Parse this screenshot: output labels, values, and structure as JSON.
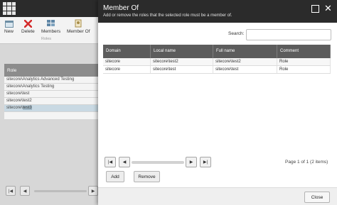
{
  "app": {
    "ribbon": {
      "new_label": "New",
      "delete_label": "Delete",
      "members_label": "Members",
      "member_of_label": "Member Of",
      "group_label": "Roles"
    },
    "role_list": {
      "header": "Role",
      "rows": [
        "sitecore\\Analytics Advanced Testing",
        "sitecore\\Analytics Testing",
        "sitecore\\test",
        "sitecore\\test2"
      ],
      "selected_prefix": "sitecore\\",
      "selected_highlight": "test3"
    },
    "pager": {
      "first": "|◀",
      "prev": "◀",
      "next": "▶"
    }
  },
  "dialog": {
    "title": "Member Of",
    "subtitle": "Add or remove the roles that the selected role must be a member of.",
    "search_label": "Search:",
    "search_value": "",
    "columns": [
      "Domain",
      "Local name",
      "Full name",
      "Comment"
    ],
    "rows": [
      [
        "sitecore",
        "sitecore\\test2",
        "sitecore\\test2",
        "Role"
      ],
      [
        "sitecore",
        "sitecore\\test",
        "sitecore\\test",
        "Role"
      ]
    ],
    "pager": {
      "first": "|◀",
      "prev": "◀",
      "next": "▶",
      "last": "▶|",
      "info": "Page 1 of 1 (2 items)"
    },
    "add_label": "Add",
    "remove_label": "Remove",
    "close_label": "Close"
  },
  "colors": {
    "header_bg": "#2b2b2b",
    "grid_header_bg": "#5c5c5c",
    "selected_row": "#c9d9e3",
    "delete_icon": "#d42a2a"
  }
}
